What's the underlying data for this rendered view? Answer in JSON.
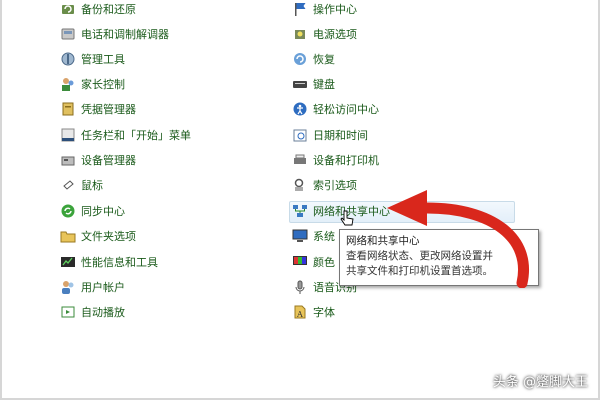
{
  "left_items": [
    {
      "label": "备份和还原",
      "icon": "backup-restore-icon"
    },
    {
      "label": "电话和调制解调器",
      "icon": "phone-modem-icon"
    },
    {
      "label": "管理工具",
      "icon": "admin-tools-icon"
    },
    {
      "label": "家长控制",
      "icon": "parental-controls-icon"
    },
    {
      "label": "凭据管理器",
      "icon": "credential-manager-icon"
    },
    {
      "label": "任务栏和「开始」菜单",
      "icon": "taskbar-start-icon"
    },
    {
      "label": "设备管理器",
      "icon": "device-manager-icon"
    },
    {
      "label": "鼠标",
      "icon": "mouse-icon"
    },
    {
      "label": "同步中心",
      "icon": "sync-center-icon"
    },
    {
      "label": "文件夹选项",
      "icon": "folder-options-icon"
    },
    {
      "label": "性能信息和工具",
      "icon": "performance-icon"
    },
    {
      "label": "用户帐户",
      "icon": "user-accounts-icon"
    },
    {
      "label": "自动播放",
      "icon": "autoplay-icon"
    }
  ],
  "right_items": [
    {
      "label": "操作中心",
      "icon": "action-center-flag-icon"
    },
    {
      "label": "电源选项",
      "icon": "power-options-icon"
    },
    {
      "label": "恢复",
      "icon": "recovery-icon"
    },
    {
      "label": "键盘",
      "icon": "keyboard-icon"
    },
    {
      "label": "轻松访问中心",
      "icon": "ease-of-access-icon"
    },
    {
      "label": "日期和时间",
      "icon": "date-time-icon"
    },
    {
      "label": "设备和打印机",
      "icon": "devices-printers-icon"
    },
    {
      "label": "索引选项",
      "icon": "indexing-options-icon"
    },
    {
      "label": "网络和共享中心",
      "icon": "network-sharing-icon"
    },
    {
      "label": "系统",
      "icon": "system-icon"
    },
    {
      "label": "颜色",
      "icon": "color-management-icon"
    },
    {
      "label": "语音识别",
      "icon": "speech-recognition-icon"
    },
    {
      "label": "字体",
      "icon": "fonts-icon"
    }
  ],
  "tooltip": {
    "title": "网络和共享中心",
    "desc_line1": "查看网络状态、更改网络设置并",
    "desc_line2": "共享文件和打印机设置首选项。"
  },
  "watermark": "头条 @蹩脚大王",
  "colors": {
    "link": "#1a5a1a",
    "arrow": "#d9271c",
    "highlight": "#e3eff9"
  }
}
